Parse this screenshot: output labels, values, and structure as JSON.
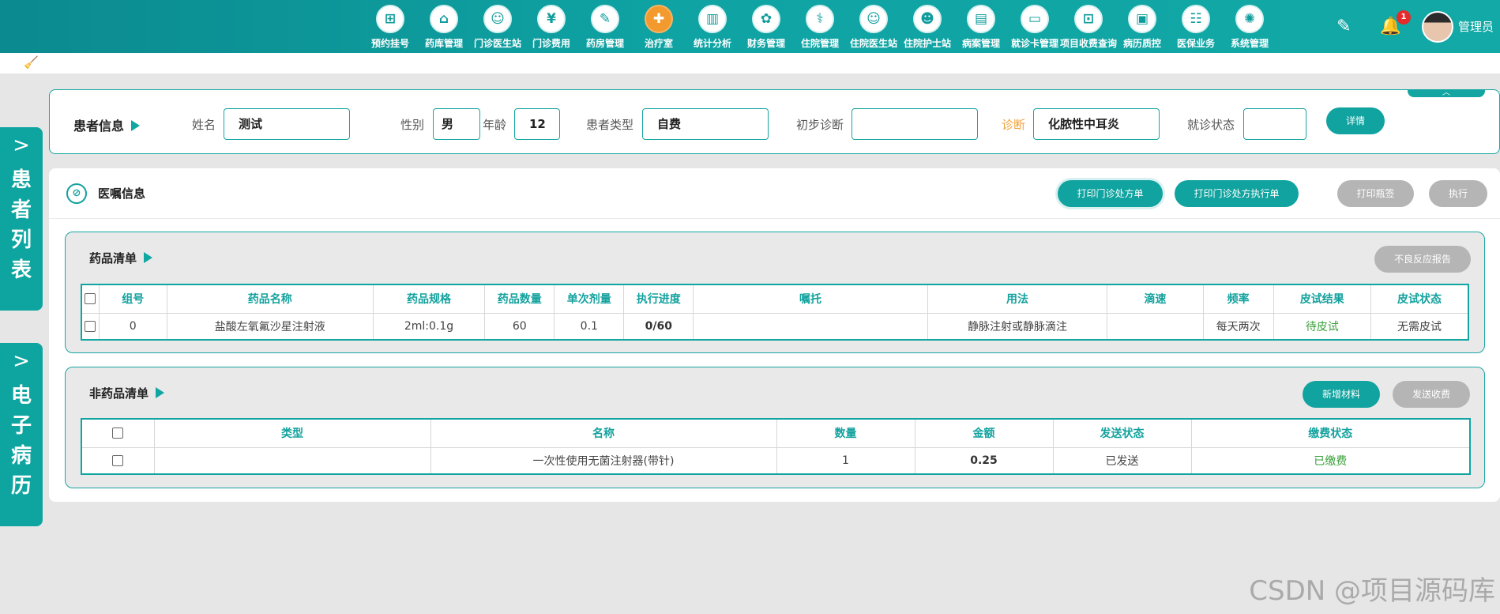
{
  "nav": {
    "items": [
      {
        "label": "预约挂号",
        "glyph": "⊞",
        "icon": "register-icon"
      },
      {
        "label": "药库管理",
        "glyph": "⌂",
        "icon": "warehouse-icon"
      },
      {
        "label": "门诊医生站",
        "glyph": "☺",
        "icon": "doctor-icon"
      },
      {
        "label": "门诊费用",
        "glyph": "¥",
        "icon": "fee-icon"
      },
      {
        "label": "药房管理",
        "glyph": "✎",
        "icon": "pharmacy-icon"
      },
      {
        "label": "治疗室",
        "glyph": "✚",
        "icon": "treatment-icon"
      },
      {
        "label": "统计分析",
        "glyph": "▥",
        "icon": "chart-icon"
      },
      {
        "label": "财务管理",
        "glyph": "✿",
        "icon": "finance-icon"
      },
      {
        "label": "住院管理",
        "glyph": "⚕",
        "icon": "hospital-icon"
      },
      {
        "label": "住院医生站",
        "glyph": "☺",
        "icon": "ward-doctor-icon"
      },
      {
        "label": "住院护士站",
        "glyph": "☻",
        "icon": "nurse-icon"
      },
      {
        "label": "病案管理",
        "glyph": "▤",
        "icon": "record-icon"
      },
      {
        "label": "就诊卡管理",
        "glyph": "▭",
        "icon": "card-icon"
      },
      {
        "label": "项目收费查询",
        "glyph": "⊡",
        "icon": "charge-query-icon"
      },
      {
        "label": "病历质控",
        "glyph": "▣",
        "icon": "quality-icon"
      },
      {
        "label": "医保业务",
        "glyph": "☷",
        "icon": "insurance-icon"
      },
      {
        "label": "系统管理",
        "glyph": "✺",
        "icon": "settings-icon"
      }
    ],
    "active_index": 5,
    "notification_count": "1",
    "user": "管理员"
  },
  "side": {
    "patient_list": "患者列表",
    "emr": "电子病历"
  },
  "patient": {
    "title": "患者信息",
    "name_label": "姓名",
    "name": "测试",
    "gender_label": "性别",
    "gender": "男",
    "age_label": "年龄",
    "age": "12",
    "type_label": "患者类型",
    "type": "自费",
    "initial_diag_label": "初步诊断",
    "initial_diag": "",
    "diag_label": "诊断",
    "diag": "化脓性中耳炎",
    "visit_status_label": "就诊状态",
    "visit_status": "",
    "detail_btn": "详情"
  },
  "orders": {
    "title": "医嘱信息",
    "print_prescription": "打印门诊处方单",
    "print_exec": "打印门诊处方执行单",
    "print_label": "打印瓶签",
    "execute": "执行"
  },
  "drugs": {
    "title": "药品清单",
    "adverse_report": "不良反应报告",
    "headers": [
      "组号",
      "药品名称",
      "药品规格",
      "药品数量",
      "单次剂量",
      "执行进度",
      "嘱托",
      "用法",
      "滴速",
      "频率",
      "皮试结果",
      "皮试状态"
    ],
    "rows": [
      [
        "0",
        "盐酸左氧氟沙星注射液",
        "2ml:0.1g",
        "60",
        "0.1",
        "0/60",
        "",
        "静脉注射或静脉滴注",
        "",
        "每天两次",
        "待皮试",
        "无需皮试"
      ]
    ]
  },
  "nondrugs": {
    "title": "非药品清单",
    "add_material": "新增材料",
    "send_charge": "发送收费",
    "headers": [
      "类型",
      "名称",
      "数量",
      "金额",
      "发送状态",
      "缴费状态"
    ],
    "rows": [
      [
        "",
        "一次性使用无菌注射器(带针)",
        "1",
        "0.25",
        "已发送",
        "已缴费"
      ]
    ]
  },
  "watermark": "CSDN @项目源码库",
  "colors": {
    "accent": "#10a39f",
    "active_nav": "#f39a2f",
    "orange_label": "#f2a23a",
    "paid_green": "#3aa13a"
  }
}
